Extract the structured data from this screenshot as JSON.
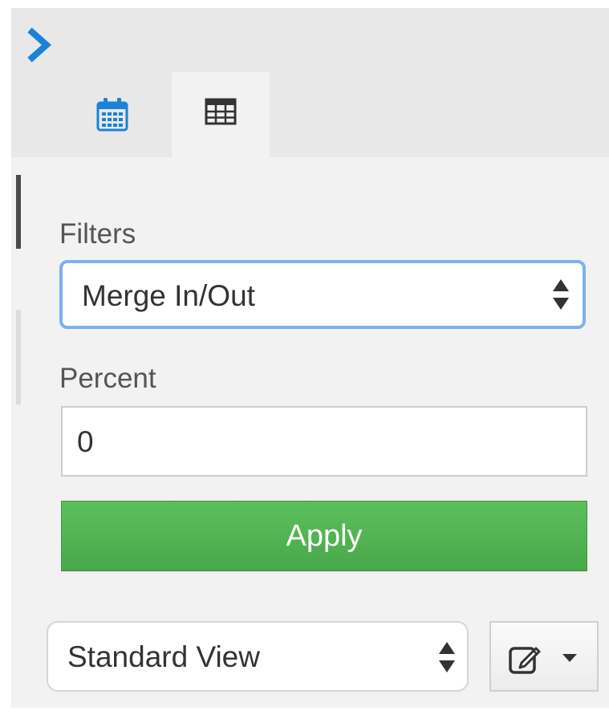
{
  "sidebar": {
    "tabs": [
      {
        "icon": "calendar-icon",
        "active": false,
        "color": "#1a82d8"
      },
      {
        "icon": "table-grid-icon",
        "active": true,
        "color": "#333333"
      }
    ]
  },
  "filters": {
    "label": "Filters",
    "selected": "Merge In/Out"
  },
  "percent": {
    "label": "Percent",
    "value": "0"
  },
  "apply": {
    "label": "Apply",
    "color": "#4cae4c"
  },
  "view": {
    "selected": "Standard View"
  },
  "colors": {
    "accent": "#1a82d8",
    "focus_ring": "#7fb0ef",
    "panel_bg": "#f2f2f2"
  }
}
